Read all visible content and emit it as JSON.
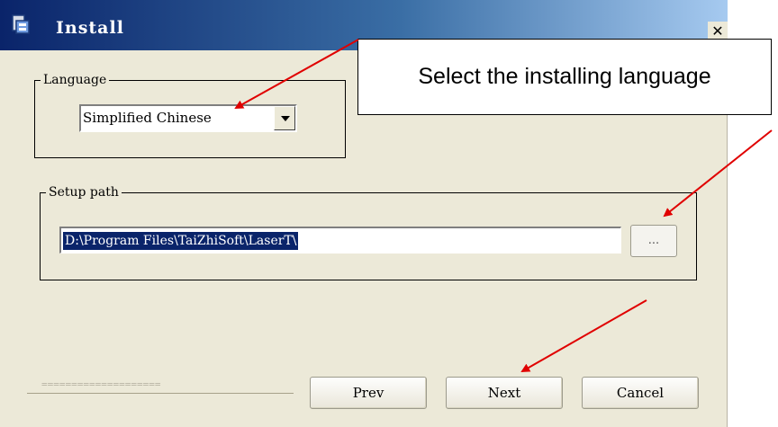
{
  "window": {
    "title": "Install",
    "close_glyph": "✕",
    "app_icon": "installer-icon"
  },
  "language_group": {
    "label": "Language",
    "selected": "Simplified Chinese"
  },
  "setup_group": {
    "label": "Setup path",
    "path": "D:\\Program Files\\TaiZhiSoft\\LaserT\\",
    "browse_label": "..."
  },
  "progress": {
    "dots": "===================="
  },
  "buttons": {
    "prev": "Prev",
    "next": "Next",
    "cancel": "Cancel"
  },
  "callout": {
    "text": "Select the installing language"
  },
  "colors": {
    "dialog_bg": "#ece9d8",
    "selection": "#0a246a",
    "annotation_arrow": "#e00000"
  }
}
